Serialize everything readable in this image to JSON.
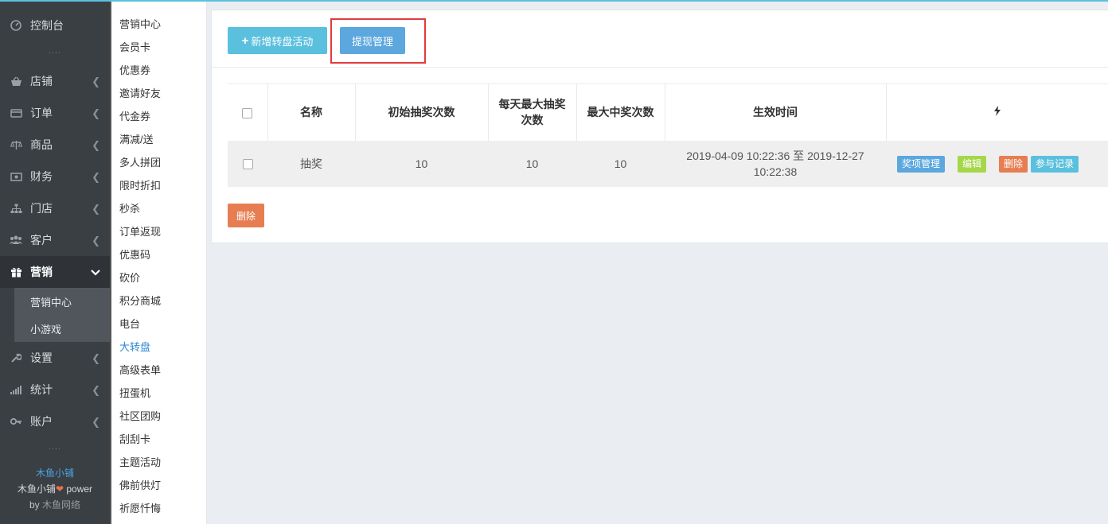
{
  "sidebar": {
    "items": [
      {
        "label": "控制台",
        "icon": "dashboard-icon"
      },
      {
        "label": "店铺",
        "icon": "shop-basket-icon"
      },
      {
        "label": "订单",
        "icon": "order-icon"
      },
      {
        "label": "商品",
        "icon": "scale-icon"
      },
      {
        "label": "财务",
        "icon": "money-icon"
      },
      {
        "label": "门店",
        "icon": "sitemap-icon"
      },
      {
        "label": "客户",
        "icon": "users-icon"
      },
      {
        "label": "营销",
        "icon": "gift-icon"
      },
      {
        "label": "设置",
        "icon": "wrench-icon"
      },
      {
        "label": "统计",
        "icon": "signal-icon"
      },
      {
        "label": "账户",
        "icon": "key-icon"
      }
    ],
    "marketing_sub": [
      "营销中心",
      "小游戏"
    ],
    "dots": "....",
    "footer": {
      "brand": "木鱼小铺",
      "line2_a": "木鱼小铺",
      "line2_b": " power",
      "line3_a": "by ",
      "line3_b": "木鱼网络"
    }
  },
  "sub_sidebar": {
    "items": [
      "营销中心",
      "会员卡",
      "优惠券",
      "邀请好友",
      "代金券",
      "满减/送",
      "多人拼团",
      "限时折扣",
      "秒杀",
      "订单返现",
      "优惠码",
      "砍价",
      "积分商城",
      "电台",
      "大转盘",
      "高级表单",
      "扭蛋机",
      "社区团购",
      "刮刮卡",
      "主题活动",
      "佛前供灯",
      "祈愿忏悔"
    ],
    "current": "大转盘"
  },
  "toolbar": {
    "add_label": "新增转盘活动",
    "withdraw_label": "提现管理"
  },
  "table": {
    "headers": [
      "名称",
      "初始抽奖次数",
      "每天最大抽奖次数",
      "最大中奖次数",
      "生效时间"
    ],
    "ops_header_icon": "lightning-icon",
    "rows": [
      {
        "name": "抽奖",
        "initial": "10",
        "daily_max": "10",
        "max_win": "10",
        "time": "2019-04-09 10:22:36 至 2019-12-27 10:22:38",
        "actions": {
          "prize": "奖项管理",
          "edit": "编辑",
          "delete": "删除",
          "log": "参与记录"
        }
      }
    ]
  },
  "bulk_delete_label": "删除",
  "colors": {
    "accent": "#5bc0de",
    "primary": "#5ba7de",
    "danger": "#e67e52",
    "success": "#a6d64a",
    "highlight": "#e23b3b"
  }
}
